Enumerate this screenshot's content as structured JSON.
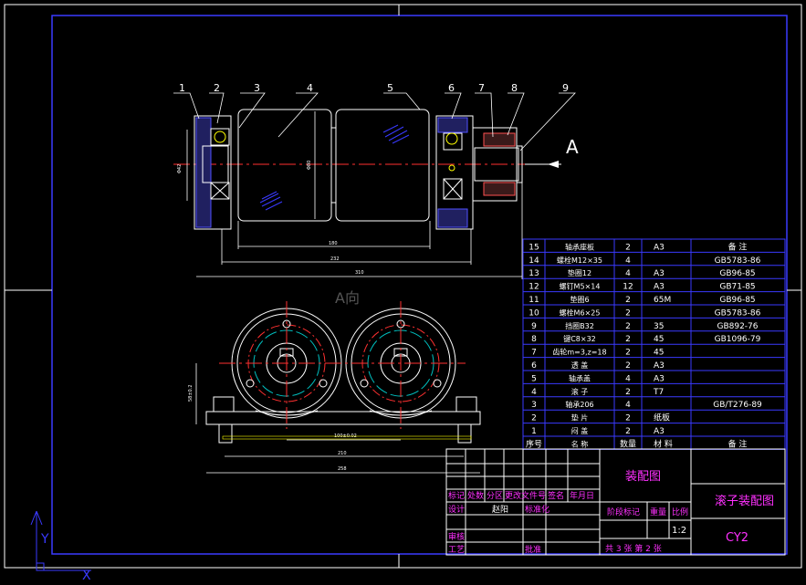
{
  "drawing": {
    "view_label_a": "A",
    "view_label_a_direction": "A向",
    "callouts": [
      "1",
      "2",
      "3",
      "4",
      "5",
      "6",
      "7",
      "8",
      "9"
    ],
    "dims_top": {
      "left_height": "Φ42",
      "roller_dia": "Φ80",
      "roller_len": "180",
      "overall1": "232",
      "overall2": "310"
    },
    "dims_bottom": {
      "base_h": "58±0.2",
      "center_dist": "100±0.02",
      "width1": "210",
      "width2": "258"
    }
  },
  "bom": {
    "rows": [
      {
        "no": "15",
        "name": "轴承座板",
        "qty": "2",
        "mat": "A3",
        "note": "备  注"
      },
      {
        "no": "14",
        "name": "螺栓M12×35",
        "qty": "4",
        "mat": "",
        "note": "GB5783-86"
      },
      {
        "no": "13",
        "name": "垫圈12",
        "qty": "4",
        "mat": "A3",
        "note": "GB96-85"
      },
      {
        "no": "12",
        "name": "螺钉M5×14",
        "qty": "12",
        "mat": "A3",
        "note": "GB71-85"
      },
      {
        "no": "11",
        "name": "垫圈6",
        "qty": "2",
        "mat": "65M",
        "note": "GB96-85"
      },
      {
        "no": "10",
        "name": "螺栓M6×25",
        "qty": "2",
        "mat": "",
        "note": "GB5783-86"
      },
      {
        "no": "9",
        "name": "挡圈B32",
        "qty": "2",
        "mat": "35",
        "note": "GB892-76"
      },
      {
        "no": "8",
        "name": "键C8×32",
        "qty": "2",
        "mat": "45",
        "note": "GB1096-79"
      },
      {
        "no": "7",
        "name": "齿轮m=3,z=18",
        "qty": "2",
        "mat": "45",
        "note": ""
      },
      {
        "no": "6",
        "name": "透  盖",
        "qty": "2",
        "mat": "A3",
        "note": ""
      },
      {
        "no": "5",
        "name": "轴承盖",
        "qty": "4",
        "mat": "A3",
        "note": ""
      },
      {
        "no": "4",
        "name": "滚  子",
        "qty": "2",
        "mat": "T7",
        "note": ""
      },
      {
        "no": "3",
        "name": "轴承206",
        "qty": "4",
        "mat": "",
        "note": "GB/T276-89"
      },
      {
        "no": "2",
        "name": "垫  片",
        "qty": "2",
        "mat": "纸板",
        "note": ""
      },
      {
        "no": "1",
        "name": "闷  盖",
        "qty": "2",
        "mat": "A3",
        "note": ""
      }
    ],
    "header": {
      "no": "序号",
      "name": "名  称",
      "qty": "数量",
      "mat": "材  料",
      "note": "备  注"
    }
  },
  "title_block": {
    "drawing_type": "装配图",
    "drawing_name": "滚子装配图",
    "drawing_code": "CY2",
    "scale_label": "比例",
    "scale": "1:2",
    "weight_label": "重量",
    "stage_label": "阶段标记",
    "sheets": "共 3 张  第 2 张",
    "row_labels": [
      "标记",
      "处数",
      "分区",
      "更改文件号",
      "签名",
      "年月日"
    ],
    "designer_label": "设计",
    "designer": "赵阳",
    "standard_label": "标准化",
    "review_label": "审核",
    "process_label": "工艺",
    "approve_label": "批准"
  }
}
